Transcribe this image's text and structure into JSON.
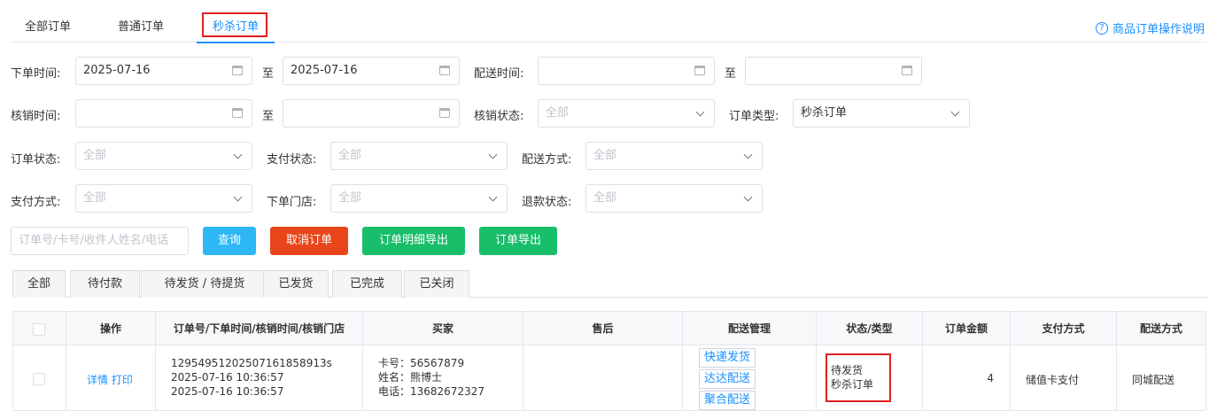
{
  "top_tabs": [
    "全部订单",
    "普通订单",
    "秒杀订单"
  ],
  "help_link": "商品订单操作说明",
  "filters": {
    "order_time_label": "下单时间:",
    "order_time_from": "2025-07-16",
    "to": "至",
    "order_time_to": "2025-07-16",
    "delivery_time_label": "配送时间:",
    "verify_time_label": "核销时间:",
    "verify_status_label": "核销状态:",
    "verify_status_value": "全部",
    "order_type_label": "订单类型:",
    "order_type_value": "秒杀订单",
    "order_status_label": "订单状态:",
    "order_status_value": "全部",
    "pay_status_label": "支付状态:",
    "pay_status_value": "全部",
    "delivery_method_label": "配送方式:",
    "delivery_method_value": "全部",
    "pay_method_label": "支付方式:",
    "pay_method_value": "全部",
    "store_label": "下单门店:",
    "store_value": "全部",
    "refund_status_label": "退款状态:",
    "refund_status_value": "全部",
    "search_placeholder": "订单号/卡号/收件人姓名/电话"
  },
  "buttons": {
    "query": "查询",
    "cancel_order": "取消订单",
    "export_detail": "订单明细导出",
    "export": "订单导出"
  },
  "colors": {
    "query": "#2db7f5",
    "cancel_order": "#e8461a",
    "export": "#19be6b",
    "accent": "#1890ff",
    "highlight_box": "#e02020"
  },
  "status_tabs": [
    "全部",
    "待付款",
    "待发货 / 待提货",
    "已发货",
    "已完成",
    "已关闭"
  ],
  "table": {
    "headers": [
      "操作",
      "订单号/下单时间/核销时间/核销门店",
      "买家",
      "售后",
      "配送管理",
      "状态/类型",
      "订单金额",
      "支付方式",
      "配送方式"
    ],
    "rows": [
      {
        "actions": [
          "详情",
          "打印"
        ],
        "order_no": "12954951202507161858913s",
        "order_time": "2025-07-16 10:36:57",
        "verify_time": "2025-07-16 10:36:57",
        "buyer_card": "卡号：56567879",
        "buyer_name": "姓名：熊博士",
        "buyer_phone": "电话：13682672327",
        "after_sale": "",
        "delivery_buttons": [
          "快递发货",
          "达达配送",
          "聚合配送"
        ],
        "status": "待发货",
        "type": "秒杀订单",
        "amount": "4",
        "pay_method": "储值卡支付",
        "delivery_method": "同城配送"
      }
    ]
  }
}
